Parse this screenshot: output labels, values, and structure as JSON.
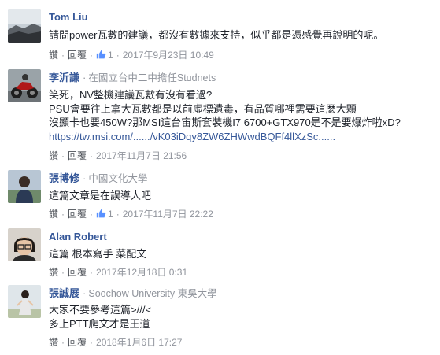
{
  "actions": {
    "reply": "讚",
    "replyto": "回覆"
  },
  "comments": [
    {
      "author": "Tom Liu",
      "affiliation": "",
      "lines": [
        "請問power瓦數的建議，都沒有數據來支持，似乎都是憑感覺再說明的呢。"
      ],
      "like_count": "1",
      "timestamp": "2017年9月23日 10:49",
      "avatar": "landscape-avatar"
    },
    {
      "author": "李沂謙",
      "affiliation": "在國立台中二中擔任Studnets",
      "lines": [
        "笑死，NV整機建議瓦數有沒有看過?",
        "PSU會要往上拿大瓦數都是以前虛標遺毒，有品質哪裡需要這麼大顆",
        "沒顯卡也要450W?那MSI這台宙斯套裝機I7 6700+GTX970是不是要爆炸啦xD?"
      ],
      "link": "https://tw.msi.com/....../vK03iDqy8ZW6ZHWwdBQFf4llXzSc......",
      "like_count": "",
      "timestamp": "2017年11月7日 21:56",
      "avatar": "motorcycle-avatar"
    },
    {
      "author": "張博修",
      "affiliation": "中國文化大學",
      "lines": [
        "這篇文章是在誤導人吧"
      ],
      "like_count": "1",
      "timestamp": "2017年11月7日 22:22",
      "avatar": "person-avatar"
    },
    {
      "author": "Alan Robert",
      "affiliation": "",
      "lines": [
        "這篇 根本寫手 菜配文"
      ],
      "like_count": "",
      "timestamp": "2017年12月18日 0:31",
      "avatar": "glasses-person-avatar"
    },
    {
      "author": "張誠展",
      "affiliation": "Soochow University 東吳大學",
      "lines": [
        "大家不要參考這篇>///<",
        "多上PTT爬文才是王道"
      ],
      "like_count": "",
      "timestamp": "2018年1月6日 17:27",
      "avatar": "outdoor-person-avatar"
    }
  ]
}
